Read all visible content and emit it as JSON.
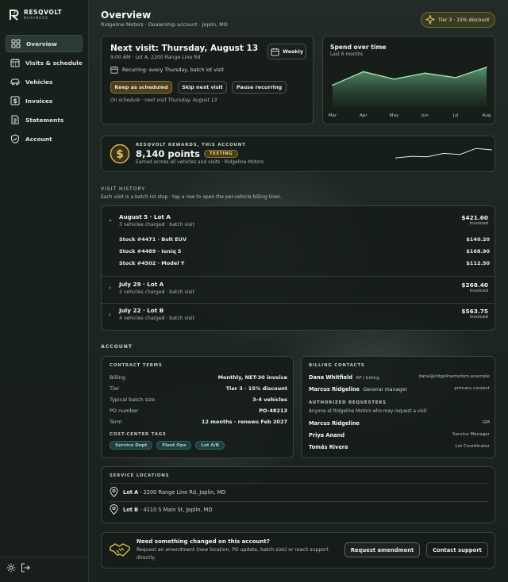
{
  "brand": {
    "name": "RESQVOLT",
    "sub": "BUSINESS"
  },
  "nav": [
    {
      "label": "Overview",
      "icon": "grid-icon",
      "active": true
    },
    {
      "label": "Visits & schedule",
      "icon": "calendar-icon"
    },
    {
      "label": "Vehicles",
      "icon": "car-icon"
    },
    {
      "label": "Invoices",
      "icon": "dollar-icon"
    },
    {
      "label": "Statements",
      "icon": "document-icon"
    },
    {
      "label": "Account",
      "icon": "shield-icon"
    }
  ],
  "header": {
    "title": "Overview",
    "subtitle": "Ridgeline Motors · Dealership account · Joplin, MO",
    "tier_badge": "Tier 3 · 15% discount"
  },
  "next_visit": {
    "title": "Next visit: Thursday, August 13",
    "detail": "9:00 AM · Lot A, 2200 Range Line Rd",
    "frequency": "Weekly",
    "recurring": "Recurring: every Thursday, batch lot visit",
    "buttons": {
      "keep": "Keep as scheduled",
      "skip": "Skip next visit",
      "pause": "Pause recurring"
    },
    "status": "On schedule · next visit Thursday, August 13"
  },
  "spend": {
    "title": "Spend over time",
    "sub": "Last 6 months"
  },
  "chart_data": {
    "type": "area",
    "categories": [
      "Mar",
      "Apr",
      "May",
      "Jun",
      "Jul",
      "Aug"
    ],
    "values": [
      1450,
      1900,
      1650,
      1850,
      1700,
      2050
    ],
    "ylim": [
      0,
      2600
    ]
  },
  "rewards": {
    "label": "RESQVOLT REWARDS, THIS ACCOUNT",
    "points": "8,140 points",
    "badge": "TESTING",
    "sub": "Earned across all vehicles and visits · Ridgeline Motors",
    "trend": [
      0.35,
      0.45,
      0.42,
      0.62,
      0.55,
      0.9,
      0.82
    ]
  },
  "history": {
    "heading": "VISIT HISTORY",
    "sub": "Each visit is a batch lot stop · tap a row to open the per-vehicle billing lines.",
    "visits": [
      {
        "title": "August 5 · Lot A",
        "sub": "3 vehicles charged · batch visit",
        "amount": "$421.60",
        "status": "invoiced",
        "expanded": true,
        "lines": [
          {
            "label": "Stock #4471 · Bolt EUV",
            "amount": "$140.20"
          },
          {
            "label": "Stock #4489 · Ioniq 5",
            "amount": "$168.90"
          },
          {
            "label": "Stock #4502 · Model Y",
            "amount": "$112.50"
          }
        ]
      },
      {
        "title": "July 29 · Lot A",
        "sub": "2 vehicles charged · batch visit",
        "amount": "$268.40",
        "status": "invoiced"
      },
      {
        "title": "July 22 · Lot B",
        "sub": "4 vehicles charged · batch visit",
        "amount": "$563.75",
        "status": "invoiced"
      }
    ]
  },
  "account": {
    "heading": "ACCOUNT",
    "contract": {
      "label": "CONTRACT TERMS",
      "rows": [
        {
          "k": "Billing",
          "v": "Monthly, NET-30 invoice"
        },
        {
          "k": "Tier",
          "v": "Tier 3 · 15% discount"
        },
        {
          "k": "Typical batch size",
          "v": "3-4 vehicles"
        },
        {
          "k": "PO number",
          "v": "PO-48213"
        },
        {
          "k": "Term",
          "v": "12 months · renews Feb 2027"
        }
      ],
      "tags_label": "COST-CENTER TAGS",
      "tags": [
        "Service Dept",
        "Fleet Ops",
        "Lot A/B"
      ]
    },
    "contacts": {
      "label": "BILLING CONTACTS",
      "people": [
        {
          "name": "Dana Whitfield",
          "role": "AP / billing",
          "right": "dana@ridgelinemotors.example"
        },
        {
          "name": "Marcus Ridgeline",
          "role": "General manager",
          "right": "primary contact"
        }
      ],
      "req_label": "AUTHORIZED REQUESTERS",
      "req_sub": "Anyone at Ridgeline Motors who may request a visit",
      "requesters": [
        {
          "name": "Marcus Ridgeline",
          "role": "GM"
        },
        {
          "name": "Priya Anand",
          "role": "Service Manager"
        },
        {
          "name": "Tomás Rivera",
          "role": "Lot Coordinator"
        }
      ]
    },
    "locations": {
      "label": "SERVICE LOCATIONS",
      "items": [
        {
          "name": "Lot A",
          "addr": "· 2200 Range Line Rd, Joplin, MO"
        },
        {
          "name": "Lot B",
          "addr": "· 4110 S Main St, Joplin, MO"
        }
      ]
    }
  },
  "help": {
    "title": "Need something changed on this account?",
    "body": "Request an amendment (new location, PO update, batch size) or reach support directly.",
    "amend": "Request amendment",
    "support": "Contact support"
  }
}
